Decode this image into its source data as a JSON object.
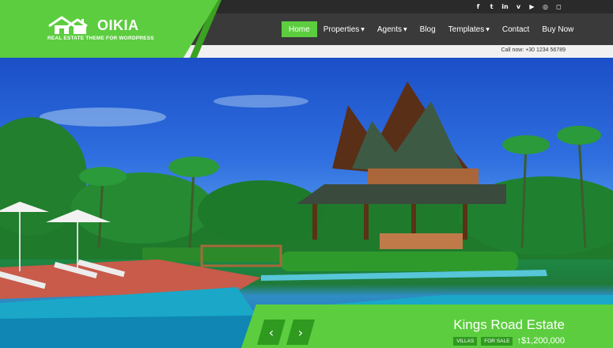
{
  "brand": {
    "name": "OIKIA",
    "tagline": "REAL ESTATE THEME FOR WORDPRESS"
  },
  "social_icons": [
    "facebook-icon",
    "twitter-icon",
    "linkedin-icon",
    "vimeo-icon",
    "youtube-icon",
    "dribbble-icon",
    "instagram-icon"
  ],
  "social_glyphs": [
    "f",
    "t",
    "in",
    "v",
    "▶",
    "◎",
    "◻"
  ],
  "nav": {
    "items": [
      {
        "label": "Home",
        "dropdown": false,
        "active": true
      },
      {
        "label": "Properties",
        "dropdown": true,
        "active": false
      },
      {
        "label": "Agents",
        "dropdown": true,
        "active": false
      },
      {
        "label": "Blog",
        "dropdown": false,
        "active": false
      },
      {
        "label": "Templates",
        "dropdown": true,
        "active": false
      },
      {
        "label": "Contact",
        "dropdown": false,
        "active": false
      },
      {
        "label": "Buy Now",
        "dropdown": false,
        "active": false
      }
    ]
  },
  "contact": {
    "call_text": "Call now: +30 1234 56789"
  },
  "slider": {
    "prev_glyph": "‹",
    "next_glyph": "›",
    "property_title": "Kings Road Estate",
    "tags": [
      "VILLAS",
      "FOR SALE"
    ],
    "price": "$1,200,000",
    "price_icon": "↑"
  },
  "colors": {
    "accent": "#5ccd3f",
    "accent_dark": "#2f9a1f",
    "topbar": "#2a2a2a",
    "navbar": "#3a3a3a"
  }
}
